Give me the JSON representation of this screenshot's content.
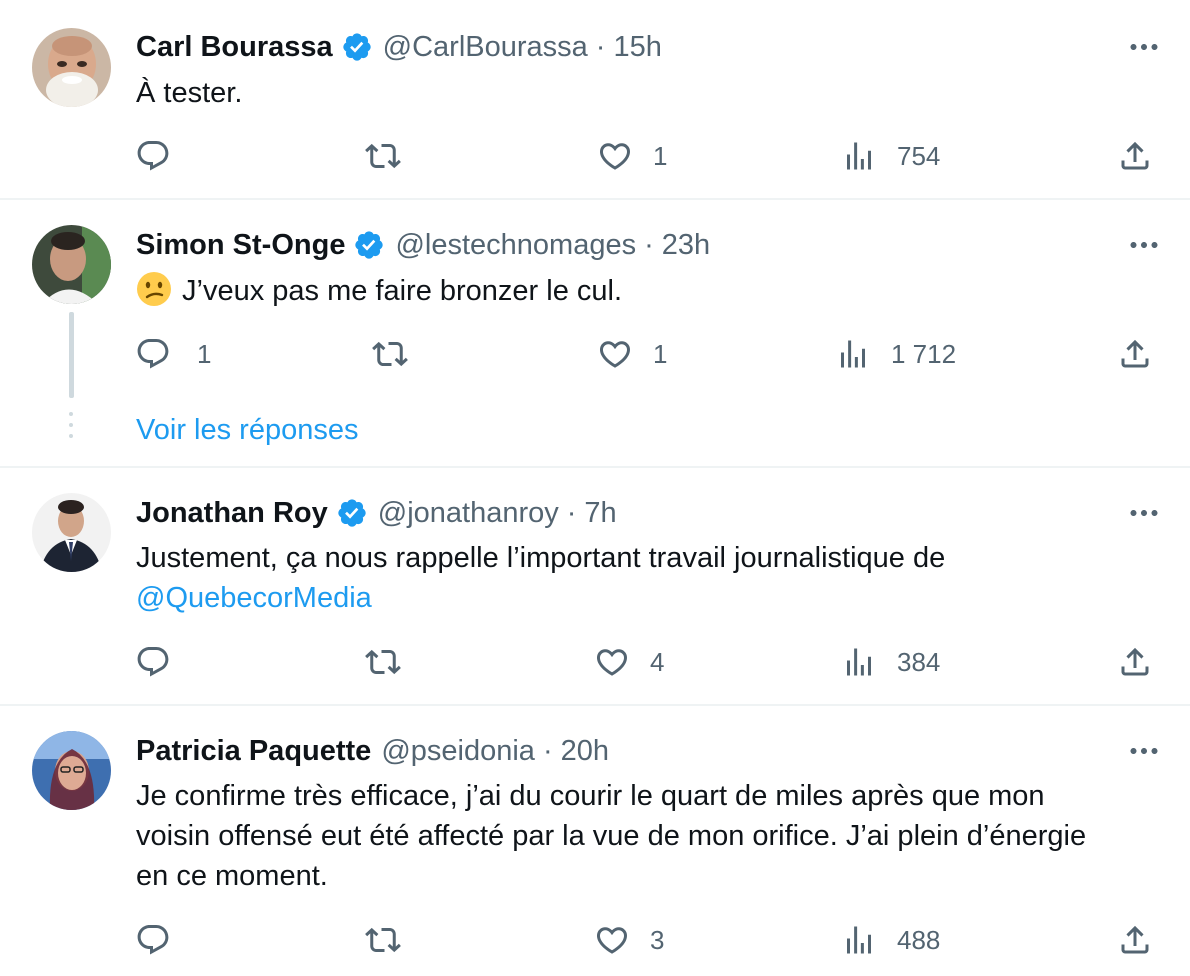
{
  "tweets": [
    {
      "name": "Carl Bourassa",
      "verified": true,
      "handle": "@CarlBourassa",
      "separator": "·",
      "time": "15h",
      "text": "À tester.",
      "replies": "",
      "likes": "1",
      "views": "754"
    },
    {
      "name": "Simon St-Onge",
      "verified": true,
      "handle": "@lestechnomages",
      "separator": "·",
      "time": "23h",
      "emoji": "confused-face",
      "text": "J’veux pas me faire bronzer le cul.",
      "replies": "1",
      "likes": "1",
      "views": "1 712",
      "show_replies": "Voir les réponses"
    },
    {
      "name": "Jonathan Roy",
      "verified": true,
      "handle": "@jonathanroy",
      "separator": "·",
      "time": "7h",
      "text_line1": "Justement, ça nous rappelle l’important travail journalistique de",
      "mention": "@QuebecorMedia",
      "replies": "",
      "likes": "4",
      "views": "384"
    },
    {
      "name": "Patricia Paquette",
      "verified": false,
      "handle": "@pseidonia",
      "separator": "·",
      "time": "20h",
      "text_lines": [
        "Je confirme très efficace, j’ai du courir le quart de miles après que mon",
        "voisin offensé eut été affecté par la vue de mon orifice. J’ai plein d’énergie",
        "en ce moment."
      ],
      "replies": "",
      "likes": "3",
      "views": "488"
    }
  ],
  "colors": {
    "text": "#0f1419",
    "secondary": "#536471",
    "accent": "#1d9bf0",
    "divider": "#eff3f4",
    "thread": "#cfd9de"
  },
  "icons": [
    "reply-icon",
    "retweet-icon",
    "like-icon",
    "views-icon",
    "share-icon",
    "more-icon",
    "verified-badge-icon"
  ]
}
